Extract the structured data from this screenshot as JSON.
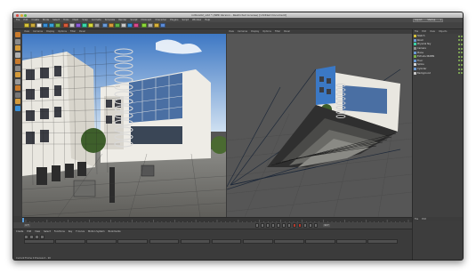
{
  "window": {
    "title": "rollbox02_v02 * (NPR Version - Restricted License) [Untitled Document]",
    "traffic_lights": [
      "#e0443b",
      "#e1a52c",
      "#5bb641"
    ]
  },
  "menu": [
    "File",
    "Edit",
    "Create",
    "Mode",
    "Select",
    "Tools",
    "Mesh",
    "Snap",
    "Animate",
    "Simulate",
    "Render",
    "Sculpt",
    "MoGraph",
    "Character",
    "Plugins",
    "Script",
    "Window",
    "Help"
  ],
  "layout": {
    "label": "Layout:",
    "value": "Startup"
  },
  "viewports": [
    {
      "menu": [
        "View",
        "Cameras",
        "Display",
        "Options",
        "Filter",
        "Panel"
      ]
    },
    {
      "menu": [
        "View",
        "Cameras",
        "Display",
        "Options",
        "Filter",
        "Panel"
      ]
    }
  ],
  "objects": {
    "header": [
      "File",
      "Edit",
      "View",
      "Objects",
      "Tags",
      "Bookmarks"
    ],
    "items": [
      "Sketch",
      "Room",
      "Physical Sky",
      "Camera",
      "Plane",
      "Extrude NURBS",
      "Floor",
      "Spline",
      "Cylinder",
      "Background"
    ]
  },
  "timeline": {
    "ticks": [
      "0",
      "5",
      "10",
      "15",
      "20",
      "25",
      "30",
      "35",
      "40",
      "45",
      "50",
      "55",
      "60",
      "65",
      "70",
      "75",
      "80",
      "85",
      "90"
    ],
    "end": "0 F"
  },
  "transport": {
    "start": "0 F",
    "end": "90 F"
  },
  "anim_tabs": [
    "Create",
    "Edit",
    "View",
    "Select",
    "Functions",
    "Key",
    "F-Curve",
    "Motion System",
    "Bookmarks"
  ],
  "status": "Current Frame  0   Preview  0 - 90",
  "colors": {
    "toolbar_icons": [
      "#d6c23a",
      "#c9a73a",
      "#e6e6e6",
      "#3a8fd6",
      "#3aa0d6",
      "#7ab24a",
      "#d65a3a",
      "#c7c7c7",
      "#8b5ad6",
      "#3ad6a7",
      "#d6d63a",
      "#a0a0a0",
      "#6a9ad6",
      "#d69a3a",
      "#5ab24a",
      "#c7c7c7",
      "#3a8fd6",
      "#d64a8a",
      "#8ad63a",
      "#aaaaaa",
      "#d6b03a",
      "#5a8ad6"
    ],
    "left_icons": [
      "#c87a2c",
      "#8a8a8a",
      "#d49a3a",
      "#b0b0b0",
      "#c87a2c",
      "#888",
      "#d49a3a",
      "#999",
      "#c87a2c",
      "#777",
      "#d49a3a",
      "#3a8fd6"
    ]
  }
}
